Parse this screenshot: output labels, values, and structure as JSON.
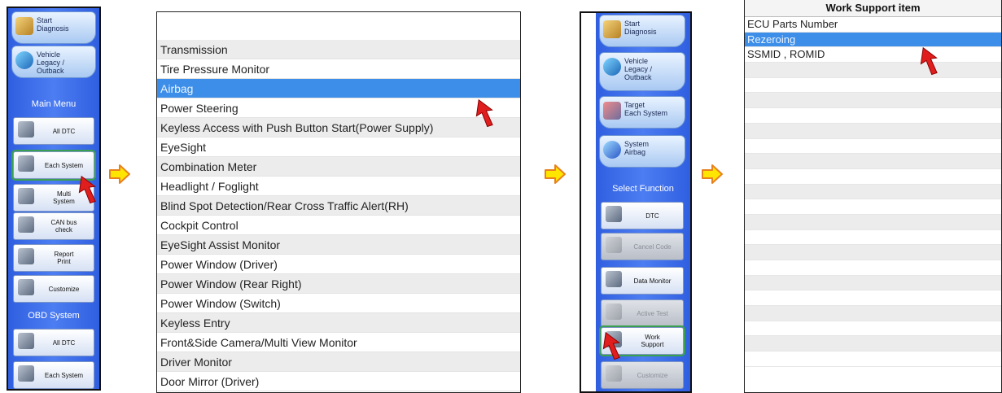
{
  "panel1": {
    "breadcrumbs": [
      {
        "label": "Start\nDiagnosis",
        "icon": "house-icon"
      },
      {
        "label": "Vehicle\nLegacy /\nOutback",
        "icon": "car-icon"
      }
    ],
    "main_menu_title": "Main Menu",
    "main_menu": [
      {
        "label": "All DTC",
        "icon": "dtc-icon"
      },
      {
        "label": "Each System",
        "icon": "each-system-icon"
      },
      {
        "label": "Multi\nSystem",
        "icon": "multi-system-icon"
      },
      {
        "label": "CAN bus\ncheck",
        "icon": "can-bus-icon"
      },
      {
        "label": "Report\nPrint",
        "icon": "report-icon"
      },
      {
        "label": "Customize",
        "icon": "customize-icon"
      }
    ],
    "obd_title": "OBD System",
    "obd_menu": [
      {
        "label": "All DTC",
        "icon": "dtc-icon"
      },
      {
        "label": "Each System",
        "icon": "each-system-icon"
      }
    ]
  },
  "system_list": {
    "items": [
      "Transmission",
      "Tire Pressure Monitor",
      "Airbag",
      "Power Steering",
      "Keyless Access with Push Button Start(Power Supply)",
      "EyeSight",
      "Combination Meter",
      "Headlight / Foglight",
      "Blind Spot Detection/Rear Cross Traffic Alert(RH)",
      "Cockpit Control",
      "EyeSight Assist Monitor",
      "Power Window (Driver)",
      "Power Window (Rear Right)",
      "Power Window (Switch)",
      "Keyless Entry",
      "Front&Side Camera/Multi View Monitor",
      "Driver Monitor",
      "Door Mirror (Driver)"
    ],
    "selected": "Airbag"
  },
  "panel3": {
    "breadcrumbs": [
      {
        "label": "Start\nDiagnosis",
        "icon": "house-icon"
      },
      {
        "label": "Vehicle\nLegacy /\nOutback",
        "icon": "car-icon"
      },
      {
        "label": "Target\nEach System",
        "icon": "target-system-icon"
      },
      {
        "label": "System\nAirbag",
        "icon": "airbag-icon"
      }
    ],
    "section_title": "Select Function",
    "functions": [
      {
        "label": "DTC",
        "icon": "dtc-icon",
        "enabled": true
      },
      {
        "label": "Cancel Code",
        "icon": "cancel-code-icon",
        "enabled": false
      },
      {
        "label": "Data Monitor",
        "icon": "data-monitor-icon",
        "enabled": true
      },
      {
        "label": "Active Test",
        "icon": "active-test-icon",
        "enabled": false
      },
      {
        "label": "Work\nSupport",
        "icon": "work-support-icon",
        "enabled": true
      },
      {
        "label": "Customize",
        "icon": "customize-icon",
        "enabled": false
      }
    ]
  },
  "work_support": {
    "header": "Work Support item",
    "items": [
      "ECU Parts Number",
      "Rezeroing",
      "SSMID , ROMID"
    ],
    "selected": "Rezeroing",
    "empty_rows": 20
  },
  "colors": {
    "selection": "#3d8ee8",
    "panel_blue": "#3a6ae8",
    "arrow_fill": "#ffe600",
    "arrow_stroke": "#e8801e",
    "pointer": "#e01e1e"
  }
}
